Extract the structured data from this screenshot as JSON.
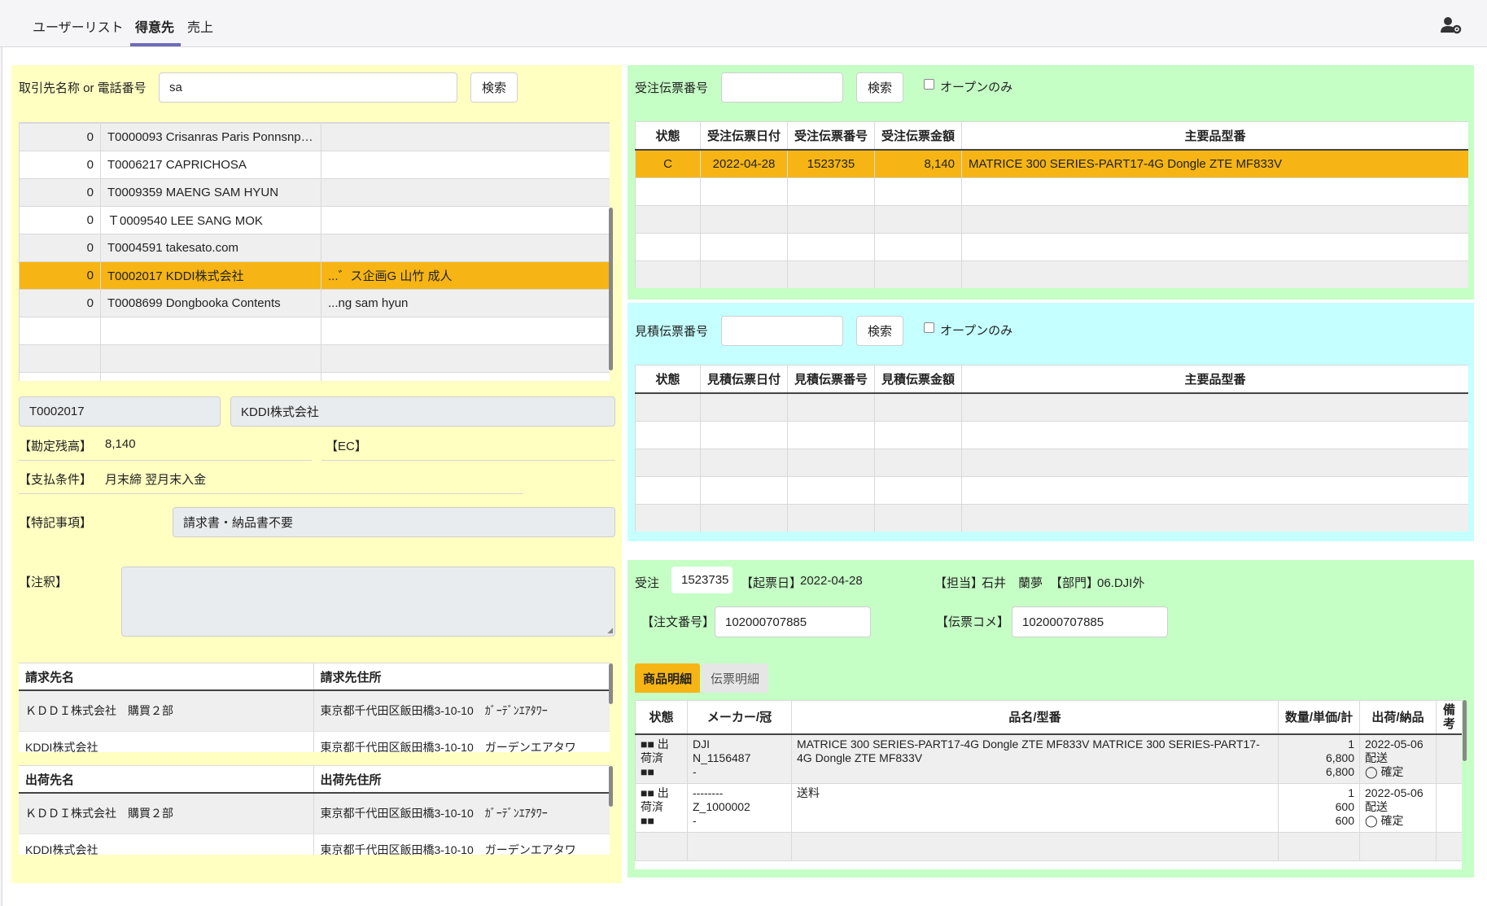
{
  "nav": {
    "tabs": [
      "ユーザーリスト",
      "得意先",
      "売上"
    ],
    "active_tab": "得意先",
    "user_settings_icon": "user-gear-icon"
  },
  "customer_search": {
    "label": "取引先名称 or 電話番号",
    "value": "sa",
    "button": "検索",
    "rows": [
      {
        "count": "0",
        "name": "T0000093 Crisanras Paris Ponnsnp…",
        "contact": ""
      },
      {
        "count": "0",
        "name": "T0006217 CAPRICHOSA",
        "contact": ""
      },
      {
        "count": "0",
        "name": "T0009359 MAENG SAM HYUN",
        "contact": ""
      },
      {
        "count": "0",
        "name": "Ｔ0009540 LEE SANG MOK",
        "contact": ""
      },
      {
        "count": "0",
        "name": "T0004591 takesato.com",
        "contact": ""
      },
      {
        "count": "0",
        "name": "T0002017 KDDI株式会社",
        "contact": "...゛ス企画G 山竹 成人"
      },
      {
        "count": "0",
        "name": "T0008699 Dongbooka Contents",
        "contact": "...ng sam hyun"
      }
    ],
    "selected_index": 5
  },
  "customer_detail": {
    "code": "T0002017",
    "name": "KDDI株式会社",
    "balance_label": "【勘定残高】",
    "balance_value": "8,140",
    "ec_label": "【EC】",
    "payment_label": "【支払条件】",
    "payment_value": "月末締 翌月末入金",
    "special_label": "【特記事項】",
    "special_value": "請求書・納品書不要",
    "note_label": "【注釈】"
  },
  "billing": {
    "headers": [
      "請求先名",
      "請求先住所"
    ],
    "rows": [
      [
        "ＫＤＤＩ株式会社　購買２部",
        "東京都千代田区飯田橋3-10-10　ｶﾞｰﾃﾞﾝｴｱﾀﾜｰ"
      ],
      [
        "KDDI株式会社",
        "東京都千代田区飯田橋3-10-10　ガーデンエアタワ"
      ]
    ]
  },
  "shipping": {
    "headers": [
      "出荷先名",
      "出荷先住所"
    ],
    "rows": [
      [
        "ＫＤＤＩ株式会社　購買２部",
        "東京都千代田区飯田橋3-10-10　ｶﾞｰﾃﾞﾝｴｱﾀﾜｰ"
      ],
      [
        "KDDI株式会社",
        "東京都千代田区飯田橋3-10-10　ガーデンエアタワ"
      ]
    ]
  },
  "orders": {
    "label": "受注伝票番号",
    "button": "検索",
    "open_only": "オープンのみ",
    "headers": [
      "状態",
      "受注伝票日付",
      "受注伝票番号",
      "受注伝票金額",
      "主要品型番"
    ],
    "rows": [
      [
        "C",
        "2022-04-28",
        "1523735",
        "8,140",
        "MATRICE 300 SERIES-PART17-4G Dongle ZTE MF833V"
      ]
    ]
  },
  "quotes": {
    "label": "見積伝票番号",
    "button": "検索",
    "open_only": "オープンのみ",
    "headers": [
      "状態",
      "見積伝票日付",
      "見積伝票番号",
      "見積伝票金額",
      "主要品型番"
    ]
  },
  "order_detail": {
    "type_label": "受注",
    "order_no": "1523735",
    "issue_label": "【起票日】",
    "issue_date": "2022-04-28",
    "staff_label": "【担当】",
    "staff": "石井　蘭夢",
    "dept_label": "【部門】",
    "dept": "06.DJI外",
    "po_label": "【注文番号】",
    "po_value": "102000707885",
    "comment_label": "【伝票コメ】",
    "comment_value": "102000707885",
    "tabs": [
      "商品明細",
      "伝票明細"
    ],
    "headers": [
      "状態",
      "メーカー/冠",
      "品名/型番",
      "数量/単価/計",
      "出荷/納品",
      "備考"
    ],
    "lines": [
      {
        "status": [
          "■■ 出",
          "荷済",
          "■■"
        ],
        "maker": [
          "DJI",
          "N_1156487",
          "-"
        ],
        "item": "MATRICE 300 SERIES-PART17-4G Dongle ZTE MF833V MATRICE 300 SERIES-PART17-4G Dongle ZTE MF833V",
        "qty": [
          "1",
          "6,800",
          "6,800"
        ],
        "ship": [
          "2022-05-06",
          "配送",
          "◯ 確定"
        ],
        "note": ""
      },
      {
        "status": [
          "■■ 出",
          "荷済",
          "■■"
        ],
        "maker": [
          "--------",
          "Z_1000002",
          "-"
        ],
        "item": "送料",
        "qty": [
          "1",
          "600",
          "600"
        ],
        "ship": [
          "2022-05-06",
          "配送",
          "◯ 確定"
        ],
        "note": ""
      }
    ]
  }
}
